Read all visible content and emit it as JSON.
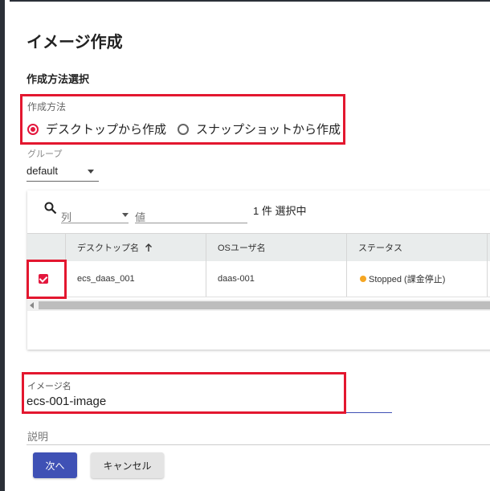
{
  "dialog": {
    "title": "イメージ作成",
    "section_title": "作成方法選択",
    "method": {
      "label": "作成方法",
      "options": [
        {
          "label": "デスクトップから作成",
          "selected": true
        },
        {
          "label": "スナップショットから作成",
          "selected": false
        }
      ]
    },
    "group": {
      "label": "グループ",
      "value": "default"
    },
    "table": {
      "column_filter_placeholder": "列",
      "value_filter_placeholder": "値",
      "selection_count": "1 件 選択中",
      "columns": [
        "デスクトップ名",
        "OSユーザ名",
        "ステータス"
      ],
      "sort_icon": "arrow-up-icon",
      "rows": [
        {
          "checked": true,
          "desktop_name": "ecs_daas_001",
          "os_user": "daas-001",
          "status": "Stopped (課金停止)",
          "status_color": "#f5a623"
        }
      ]
    },
    "image_name": {
      "label": "イメージ名",
      "value": "ecs-001-image"
    },
    "description": {
      "label": "説明"
    },
    "buttons": {
      "next": "次へ",
      "cancel": "キャンセル"
    }
  },
  "colors": {
    "accent_red": "#e3173d",
    "primary": "#3f51b5",
    "highlight_box": "#e3172f"
  }
}
